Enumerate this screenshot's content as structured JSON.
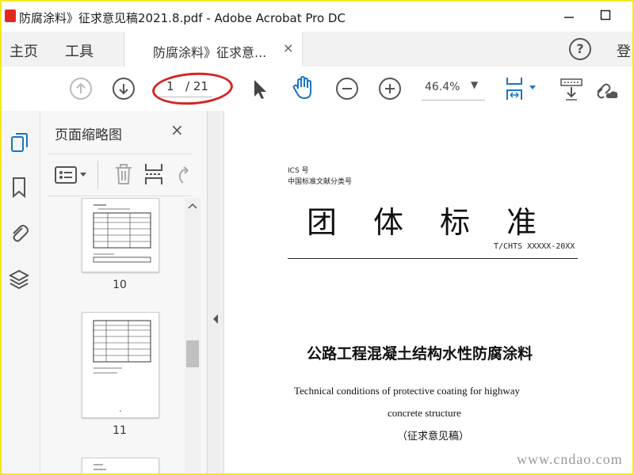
{
  "window": {
    "title": "防腐涂料》征求意见稿2021.8.pdf - Adobe Acrobat Pro DC",
    "minimize_icon": "minimize-icon",
    "maximize_icon": "maximize-icon"
  },
  "menu": {
    "home": "主页",
    "tools": "工具",
    "doc_tab": "防腐涂料》征求意...",
    "doc_tab_close": "×",
    "help": "?",
    "login": "登"
  },
  "toolbar": {
    "current_page": "1",
    "total_pages": "/ 21",
    "zoom": "46.4%",
    "zoom_arrow": "▼"
  },
  "thumbnails_panel": {
    "title": "页面缩略图",
    "close": "×",
    "pages": [
      {
        "label": "10"
      },
      {
        "label": "11"
      }
    ]
  },
  "document": {
    "ics": "ICS 号",
    "classification": "中国标准文献分类号",
    "heading": "团体标准",
    "code": "T/CHTS XXXXX-20XX",
    "title_cn": "公路工程混凝土结构水性防腐涂料",
    "title_en_line1": "Technical conditions of protective coating for highway",
    "title_en_line2": "concrete structure",
    "note": "（征求意见稿）"
  },
  "watermark": "www.cndao.com",
  "colors": {
    "frame_border": "#f5e71e",
    "annotation_red": "#d42525",
    "active_blue": "#1a73c9"
  }
}
